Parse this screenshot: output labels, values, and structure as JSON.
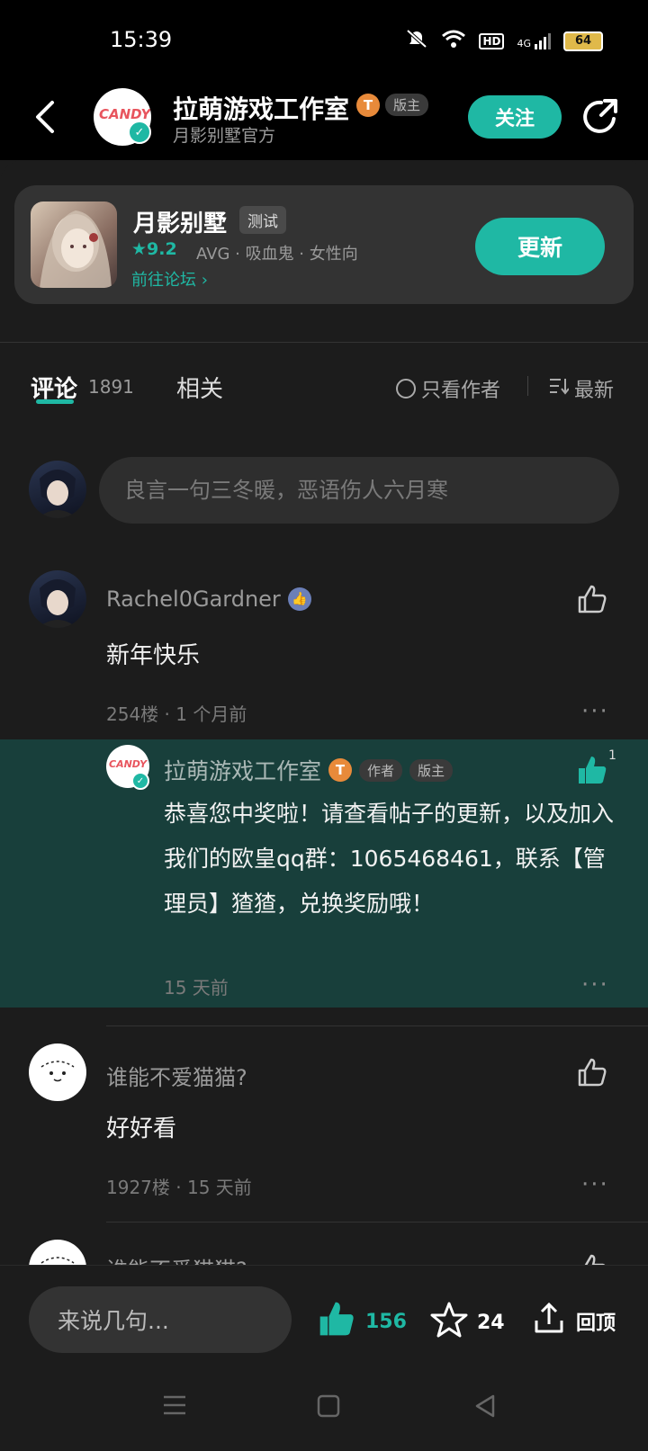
{
  "status_bar": {
    "time": "15:39",
    "battery": "64",
    "network": "4G",
    "hd": "HD"
  },
  "header": {
    "title": "拉萌游戏工作室",
    "subtitle": "月影别墅官方",
    "t_badge": "T",
    "role_badge": "版主",
    "follow_label": "关注",
    "logo_text": "CANDY"
  },
  "game_card": {
    "name": "月影别墅",
    "test_tag": "测试",
    "rating": "9.2",
    "tags": "AVG · 吸血鬼 · 女性向",
    "forum_link": "前往论坛",
    "update_label": "更新"
  },
  "tabs": {
    "comments_label": "评论",
    "comments_count": "1891",
    "related_label": "相关",
    "only_author_label": "只看作者",
    "sort_label": "最新"
  },
  "comment_input": {
    "placeholder": "良言一句三冬暖，恶语伤人六月寒"
  },
  "comments": [
    {
      "user": "Rachel0Gardner",
      "text": "新年快乐",
      "meta": "254楼 · 1 个月前",
      "reply": {
        "user": "拉萌游戏工作室",
        "author_badge": "作者",
        "role_badge": "版主",
        "text": "恭喜您中奖啦！请查看帖子的更新，以及加入我们的欧皇qq群：1065468461，联系【管理员】猹猹，兑换奖励哦！",
        "meta": "15 天前",
        "likes": "1"
      }
    },
    {
      "user": "谁能不爱猫猫?",
      "text": "好好看",
      "meta": "1927楼 · 15 天前"
    },
    {
      "user": "谁能不爱猫猫?"
    }
  ],
  "bottom_bar": {
    "input_label": "来说几句...",
    "likes": "156",
    "favorites": "24",
    "top_label": "回顶"
  },
  "colors": {
    "accent": "#1fb8a4",
    "reply_bg": "#183f3b",
    "background": "#1c1c1c"
  }
}
